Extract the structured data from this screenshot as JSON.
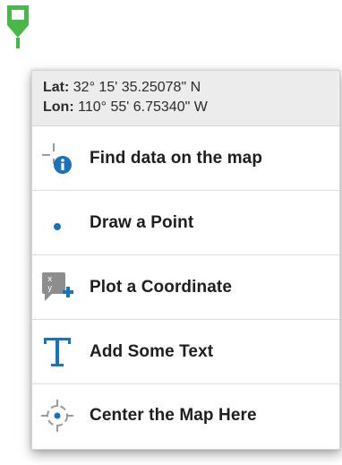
{
  "coordinates": {
    "lat_label": "Lat:",
    "lat_value": " 32° 15' 35.25078\" N",
    "lon_label": "Lon:",
    "lon_value": " 110° 55' 6.75340\" W"
  },
  "menu": [
    {
      "label": "Find data on the map",
      "icon": "identify-info-icon"
    },
    {
      "label": "Draw a Point",
      "icon": "point-dot-icon"
    },
    {
      "label": "Plot a Coordinate",
      "icon": "plot-coordinate-icon"
    },
    {
      "label": "Add Some Text",
      "icon": "text-t-icon"
    },
    {
      "label": "Center the Map Here",
      "icon": "center-target-icon"
    }
  ],
  "colors": {
    "pin_green": "#49b649",
    "icon_blue": "#1a72b8",
    "icon_gray": "#8d8d8d",
    "header_bg": "#ececec"
  }
}
